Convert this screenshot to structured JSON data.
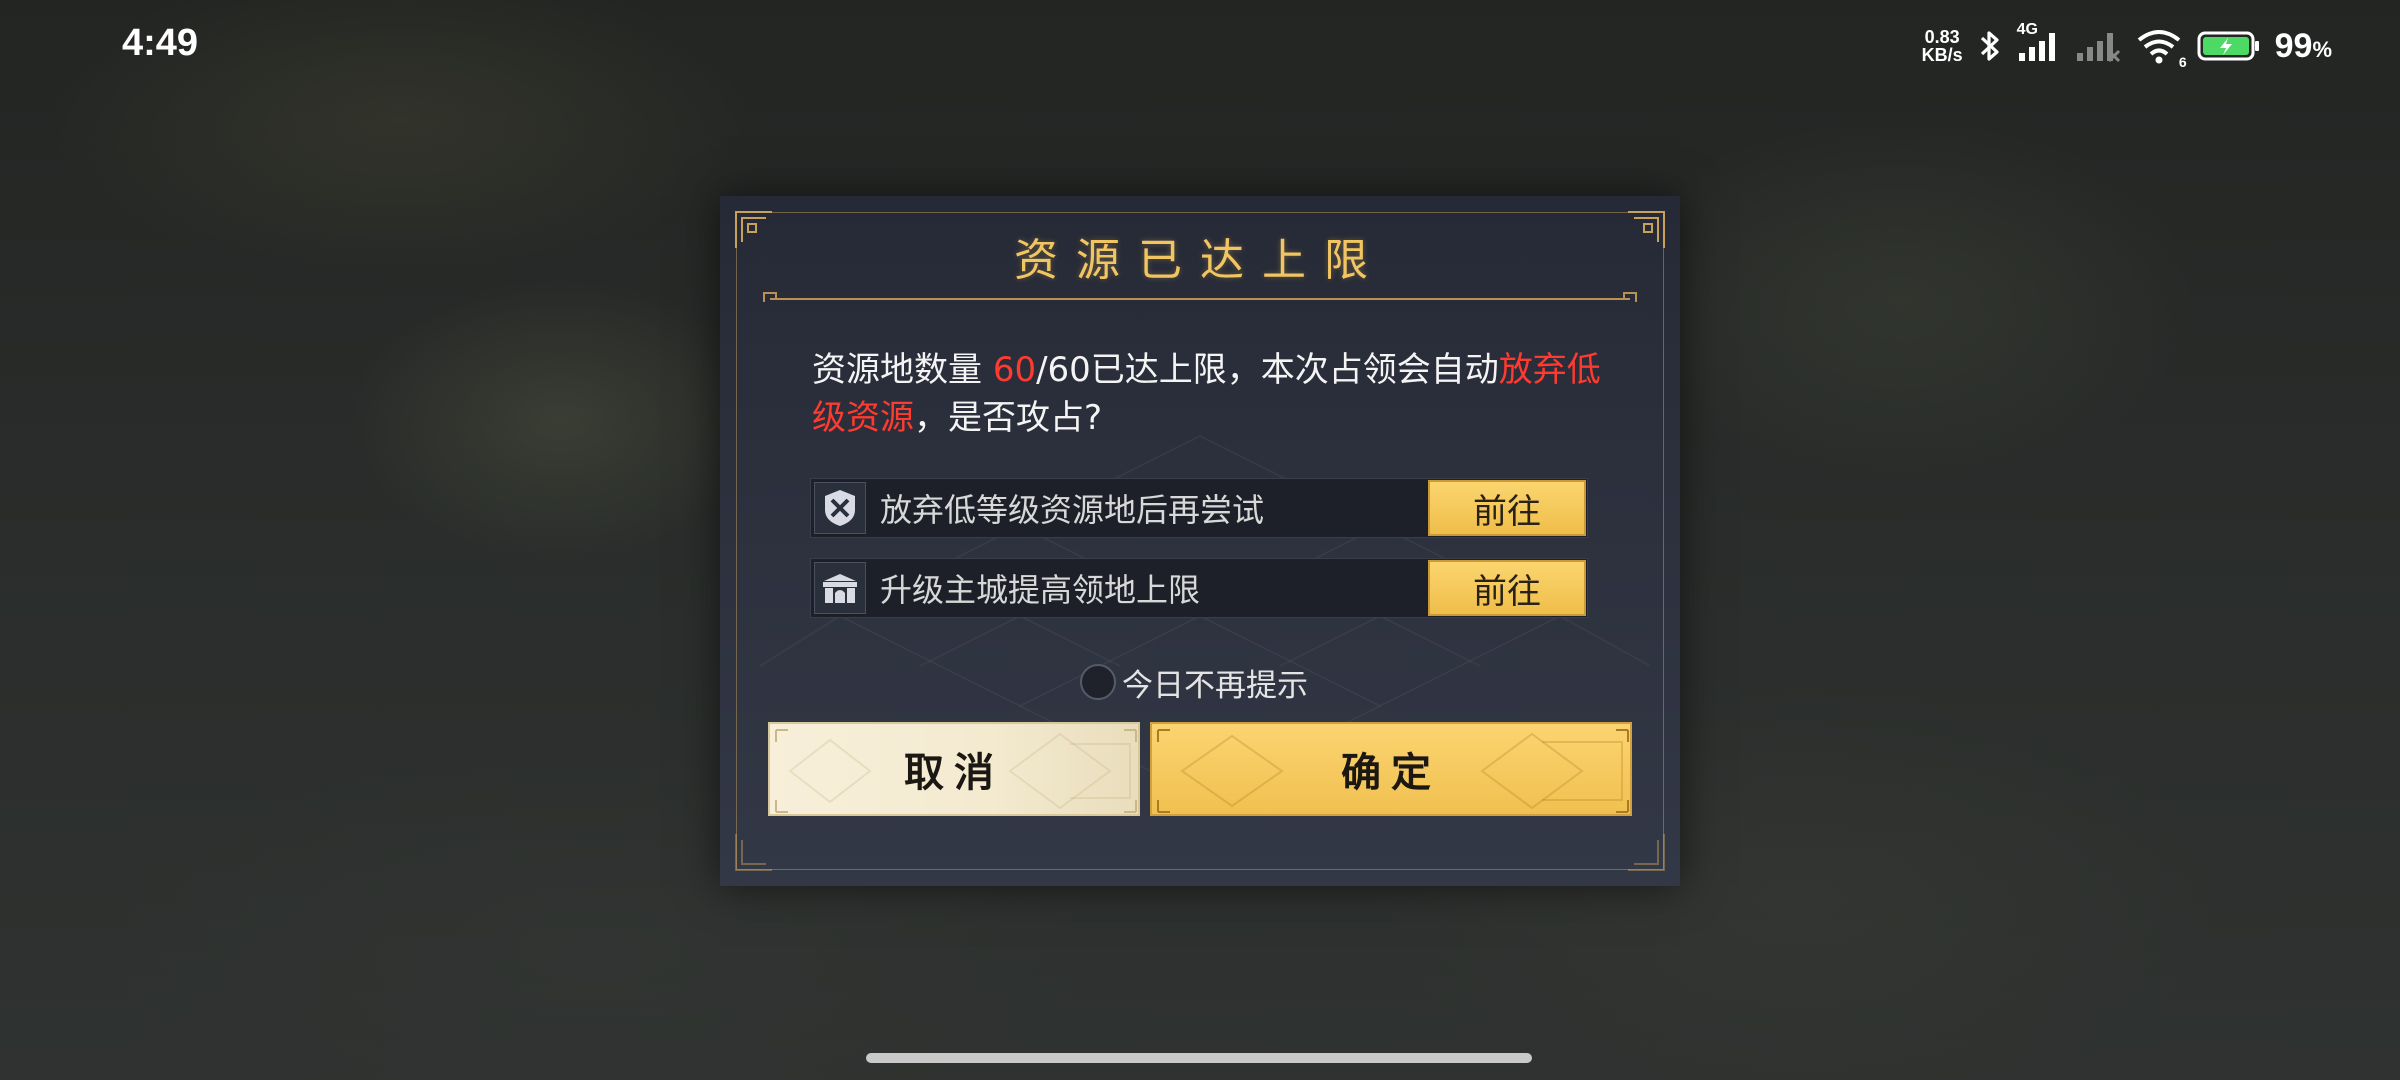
{
  "status_bar": {
    "time": "4:49",
    "net_speed_value": "0.83",
    "net_speed_unit": "KB/s",
    "network_type": "4G",
    "wifi_badge": "6",
    "battery_value": "99",
    "battery_unit": "%",
    "icons": [
      "bluetooth-icon",
      "cell-signal-icon",
      "cell-signal-no-service-icon",
      "wifi-icon",
      "battery-charging-icon"
    ]
  },
  "dialog": {
    "title": "资源已达上限",
    "message": {
      "part1": "资源地数量 ",
      "count_highlight": "60",
      "part2": "/60已达上限，本次占领会自动",
      "highlight": "放弃低级资源",
      "part3": "，是否攻占?"
    },
    "tasks": [
      {
        "icon": "abandon-land-icon",
        "label": "放弃低等级资源地后再尝试",
        "button": "前往"
      },
      {
        "icon": "city-gate-icon",
        "label": "升级主城提高领地上限",
        "button": "前往"
      }
    ],
    "remember_label": "今日不再提示",
    "remember_checked": false,
    "cancel_label": "取消",
    "confirm_label": "确定",
    "colors": {
      "title": "#f2c563",
      "highlight_red": "#ff3a2e",
      "gold_button": "#f5c85a",
      "cream_button": "#f5edd5",
      "panel": "#2c303d"
    }
  }
}
